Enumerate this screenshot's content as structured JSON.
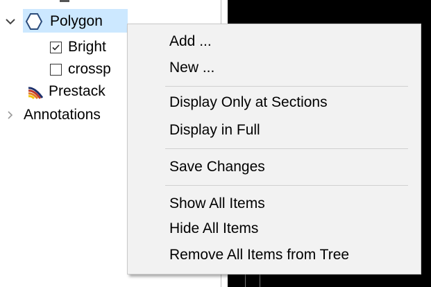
{
  "tree": {
    "items": [
      {
        "label": "Polygon",
        "icon": "polygon-icon",
        "expanded": true
      },
      {
        "label": "Bright",
        "checked": true
      },
      {
        "label": "crossp",
        "checked": false
      },
      {
        "label": "Prestack",
        "icon": "prestack-icon"
      },
      {
        "label": "Annotations",
        "expanded": false
      }
    ]
  },
  "context_menu": {
    "items": [
      "Add ...",
      "New ...",
      "Display Only at Sections",
      "Display in Full",
      "Save Changes",
      "Show All Items",
      "Hide All Items",
      "Remove All Items from Tree"
    ]
  },
  "colors": {
    "selection": "#cce8ff",
    "menu_bg": "#f2f2f2",
    "viewer_bg": "#000000"
  }
}
